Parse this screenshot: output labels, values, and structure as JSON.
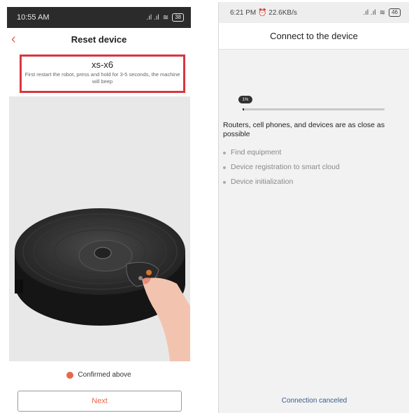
{
  "left_phone": {
    "status_bar": {
      "time": "10:55 AM",
      "icons": "ꕤ ♨",
      "signal": ".ıl .ıl",
      "wifi": "≋",
      "battery": "38"
    },
    "header": {
      "back_icon": "chevron-left-icon",
      "title": "Reset device"
    },
    "device": {
      "name": "xs-x6",
      "instruction": "First restart the robot, press and hold for 3-5 seconds, the machine will beep"
    },
    "confirm_label": "Confirmed above",
    "next_label": "Next",
    "colors": {
      "accent": "#e8684e",
      "highlight_border": "#d9363e"
    }
  },
  "right_phone": {
    "status_bar": {
      "time": "6:21 PM",
      "alarm_icon": "alarm-icon",
      "speed": "22.6KB/s",
      "signal": ".ıl .ıl",
      "wifi": "≋",
      "battery": "46"
    },
    "header": {
      "title": "Connect to the device"
    },
    "progress": {
      "label": "1%",
      "value": 1
    },
    "message": "Routers, cell phones, and devices are as close as possible",
    "steps": [
      "Find equipment",
      "Device registration to smart cloud",
      "Device initialization"
    ],
    "cancel_label": "Connection canceled"
  }
}
